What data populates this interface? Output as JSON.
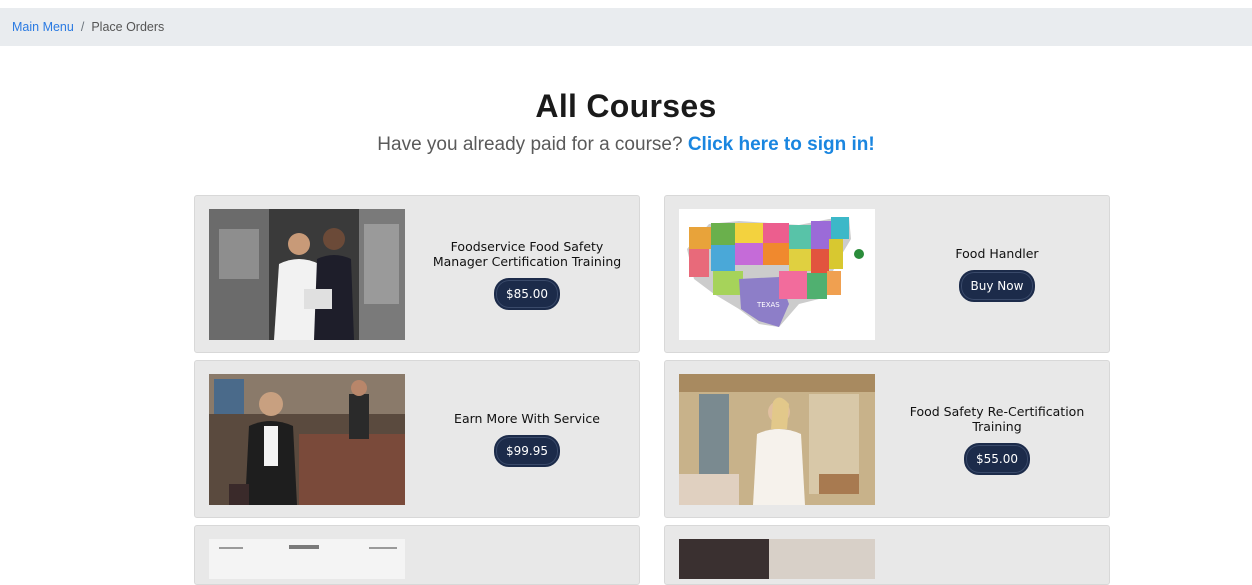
{
  "breadcrumb": {
    "items": [
      {
        "label": "Main Menu",
        "link": true
      },
      {
        "label": "Place Orders",
        "link": false
      }
    ],
    "separator": "/"
  },
  "page": {
    "title": "All Courses",
    "subtitle_prefix": "Have you already paid for a course? ",
    "subtitle_link": "Click here to sign in!"
  },
  "courses": [
    {
      "name": "Foodservice Food Safety Manager Certification Training",
      "button": "$85.00",
      "image": "chef-and-manager-kitchen-photo"
    },
    {
      "name": "Food Handler",
      "button": "Buy Now",
      "image": "us-states-map-image"
    },
    {
      "name": "Earn More With Service",
      "button": "$99.95",
      "image": "waitress-at-bar-photo"
    },
    {
      "name": "Food Safety Re-Certification Training",
      "button": "$55.00",
      "image": "hostess-in-restaurant-photo"
    }
  ],
  "map_label": "TEXAS",
  "colors": {
    "breadcrumb_bg": "#e9ecef",
    "link": "#1a86e0",
    "card_bg": "#e8e8e8",
    "button_bg": "#1c2b4a"
  }
}
